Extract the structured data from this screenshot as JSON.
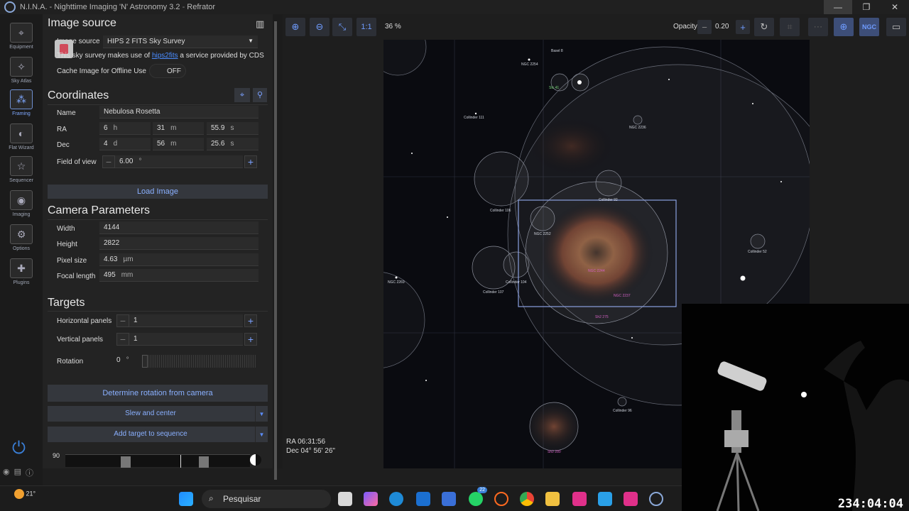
{
  "window": {
    "title_app": "N.I.N.A. - Nighttime Imaging 'N' Astronomy 3.2",
    "title_sep": "-",
    "title_profile": "Refrator",
    "minimize": "—",
    "maximize": "❐",
    "close": "✕"
  },
  "nav": [
    {
      "label": "Equipment",
      "icon": "telescope-icon"
    },
    {
      "label": "Sky Atlas",
      "icon": "map-icon"
    },
    {
      "label": "Framing",
      "icon": "framing-icon"
    },
    {
      "label": "Flat Wizard",
      "icon": "flat-wizard-icon"
    },
    {
      "label": "Sequencer",
      "icon": "stars-list-icon"
    },
    {
      "label": "Imaging",
      "icon": "camera-icon"
    },
    {
      "label": "Options",
      "icon": "gears-icon"
    },
    {
      "label": "Plugins",
      "icon": "puzzle-icon"
    }
  ],
  "nav_collapse": "< <",
  "image_source": {
    "title": "Image source",
    "label": "Image source",
    "value": "HIPS 2 FITS Sky Survey",
    "note_pre": "This sky survey makes use of ",
    "note_link": "hips2fits",
    "note_post": " a service provided by CDS",
    "cache_label": "Cache Image for Offline Use",
    "cache_value": "OFF"
  },
  "coordinates": {
    "title": "Coordinates",
    "name_label": "Name",
    "name_value": "Nebulosa Rosetta",
    "ra_label": "RA",
    "ra_h": "6",
    "ra_h_unit": "h",
    "ra_m": "31",
    "ra_m_unit": "m",
    "ra_s": "55.9",
    "ra_s_unit": "s",
    "dec_label": "Dec",
    "dec_d": "4",
    "dec_d_unit": "d",
    "dec_m": "56",
    "dec_m_unit": "m",
    "dec_s": "25.6",
    "dec_s_unit": "s",
    "fov_label": "Field of view",
    "fov_value": "6.00",
    "fov_unit": "°",
    "load_button": "Load Image"
  },
  "camera": {
    "title": "Camera Parameters",
    "width_label": "Width",
    "width_value": "4144",
    "height_label": "Height",
    "height_value": "2822",
    "pixel_label": "Pixel size",
    "pixel_value": "4.63",
    "pixel_unit": "µm",
    "focal_label": "Focal length",
    "focal_value": "495",
    "focal_unit": "mm"
  },
  "targets": {
    "title": "Targets",
    "hpanels_label": "Horizontal panels",
    "hpanels_value": "1",
    "vpanels_label": "Vertical panels",
    "vpanels_value": "1",
    "rotation_label": "Rotation",
    "rotation_value": "0",
    "rotation_unit": "°",
    "determine_button": "Determine rotation from camera",
    "slew_button": "Slew and center",
    "add_button": "Add target to sequence",
    "altitude_value": "90"
  },
  "map_toolbar": {
    "one_to_one": "1:1",
    "zoom": "36 %",
    "opacity_label": "Opacity",
    "opacity_value": "0.20",
    "ngc": "NGC"
  },
  "sky_labels": [
    "Basel 8",
    "NGC 2254",
    "Stc 41",
    "NGC 2236",
    "Collinder 111",
    "Collinder 106",
    "NGC 2252",
    "Collinder 92",
    "Collinder 52",
    "NGC 2244",
    "NGC 2237",
    "Collinder 104",
    "Collinder 107",
    "NGC 2269",
    "Sh2 275",
    "Collinder 96",
    "Sh2 280"
  ],
  "status": {
    "ra": "RA  06:31:56",
    "dec": "Dec  04° 56' 26\""
  },
  "taskbar": {
    "temperature": "21°",
    "search": "Pesquisar",
    "whatsapp_badge": "22"
  },
  "webcam": {
    "clock": "234:04:04"
  },
  "colors": {
    "accent": "#7fa8ff",
    "panel": "#232323",
    "sky": "#0a0b10",
    "frame": "#8aa0e0"
  }
}
